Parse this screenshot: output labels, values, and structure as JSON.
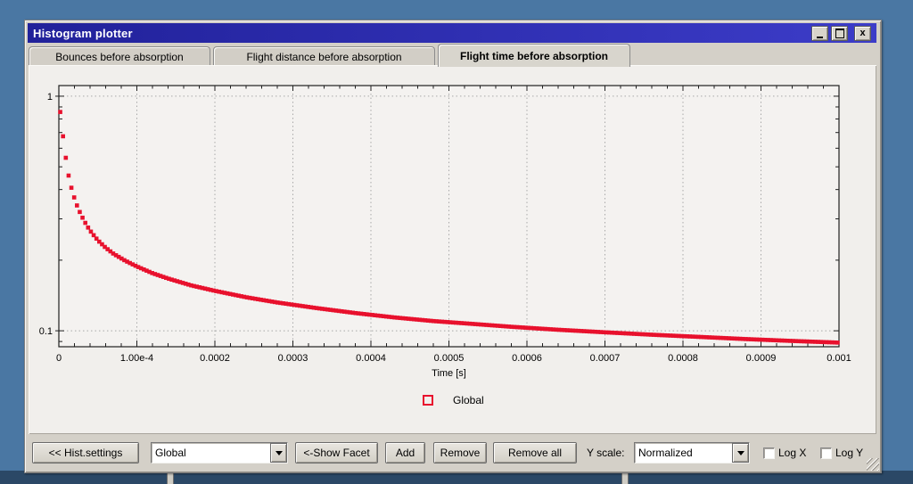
{
  "window": {
    "title": "Histogram plotter",
    "close_glyph": "x"
  },
  "tabs": [
    {
      "label": "Bounces before absorption",
      "active": false
    },
    {
      "label": "Flight distance before absorption",
      "active": false
    },
    {
      "label": "Flight time before absorption",
      "active": true
    }
  ],
  "chart_data": {
    "type": "scatter",
    "title": "",
    "xlabel": "Time [s]",
    "ylabel": "",
    "y_scale": "log",
    "grid": true,
    "xlim": [
      0,
      0.001
    ],
    "ylim": [
      0.0855,
      1.11
    ],
    "x_ticks": [
      [
        "0",
        0
      ],
      [
        "1.00e-4",
        0.0001
      ],
      [
        "0.0002",
        0.0002
      ],
      [
        "0.0003",
        0.0003
      ],
      [
        "0.0004",
        0.0004
      ],
      [
        "0.0005",
        0.0005
      ],
      [
        "0.0006",
        0.0006
      ],
      [
        "0.0007",
        0.0007
      ],
      [
        "0.0008",
        0.0008
      ],
      [
        "0.0009",
        0.0009
      ],
      [
        "0.001",
        0.001
      ]
    ],
    "y_ticks": [
      [
        "1",
        1
      ],
      [
        "0.1",
        0.1
      ]
    ],
    "y_minor_ticks": [
      0.9,
      0.8,
      0.7,
      0.6,
      0.5,
      0.4,
      0.3,
      0.2,
      0.09
    ],
    "minor_x_step": 2e-05,
    "colors": {
      "frame": "#1f1f1f",
      "grid": "#a8a8a8",
      "plot_bg": "#f4f2f0"
    },
    "series": [
      {
        "name": "Global",
        "marker": "square",
        "color": "#e8112d",
        "n_bins": 280,
        "points": [
          [
            0,
            1.0
          ],
          [
            1e-06,
            0.92
          ],
          [
            2e-06,
            0.84
          ],
          [
            4e-06,
            0.73
          ],
          [
            6e-06,
            0.65
          ],
          [
            8e-06,
            0.575
          ],
          [
            1e-05,
            0.515
          ],
          [
            1.2e-05,
            0.467
          ],
          [
            1.5e-05,
            0.42
          ],
          [
            1.8e-05,
            0.385
          ],
          [
            2.2e-05,
            0.35
          ],
          [
            2.6e-05,
            0.325
          ],
          [
            3e-05,
            0.305
          ],
          [
            3.6e-05,
            0.28
          ],
          [
            4.2e-05,
            0.262
          ],
          [
            5e-05,
            0.243
          ],
          [
            6e-05,
            0.226
          ],
          [
            7e-05,
            0.213
          ],
          [
            8.5e-05,
            0.199
          ],
          [
            0.0001,
            0.188
          ],
          [
            0.00012,
            0.176
          ],
          [
            0.00014,
            0.167
          ],
          [
            0.00017,
            0.156
          ],
          [
            0.0002,
            0.148
          ],
          [
            0.00024,
            0.139
          ],
          [
            0.00028,
            0.132
          ],
          [
            0.00033,
            0.125
          ],
          [
            0.00038,
            0.119
          ],
          [
            0.00043,
            0.114
          ],
          [
            0.00048,
            0.11
          ],
          [
            0.00053,
            0.107
          ],
          [
            0.00058,
            0.104
          ],
          [
            0.00064,
            0.101
          ],
          [
            0.0007,
            0.0985
          ],
          [
            0.00076,
            0.0962
          ],
          [
            0.00082,
            0.0942
          ],
          [
            0.00088,
            0.0922
          ],
          [
            0.00094,
            0.0905
          ],
          [
            0.001,
            0.089
          ]
        ]
      }
    ]
  },
  "legend": {
    "items": [
      {
        "label": "Global",
        "color": "#e8112d"
      }
    ]
  },
  "toolbar": {
    "hist_settings_label": "<< Hist.settings",
    "facet_select_value": "Global",
    "show_facet_label": "<-Show Facet",
    "add_label": "Add",
    "remove_label": "Remove",
    "remove_all_label": "Remove all",
    "y_scale_label": "Y scale:",
    "y_scale_select_value": "Normalized",
    "log_x": {
      "label": "Log X",
      "checked": false
    },
    "log_y": {
      "label": "Log Y",
      "checked": false
    }
  }
}
